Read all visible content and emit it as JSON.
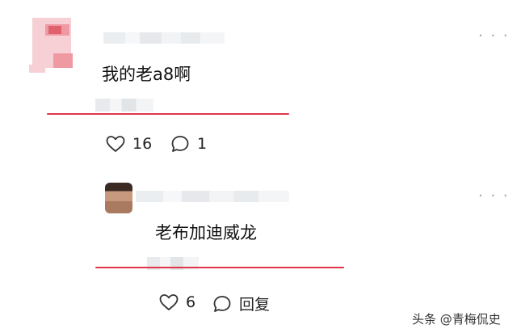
{
  "comments": [
    {
      "text": "我的老a8啊",
      "likes": "16",
      "replies": "1",
      "more_label": "· · ·"
    },
    {
      "text": "老布加迪威龙",
      "likes": "6",
      "reply_label": "回复",
      "more_label": "· · ·"
    }
  ],
  "watermark": "头条 @青梅侃史",
  "colors": {
    "underline": "#e0344a",
    "icon": "#333333"
  },
  "icons": [
    "heart-icon",
    "comment-icon"
  ]
}
